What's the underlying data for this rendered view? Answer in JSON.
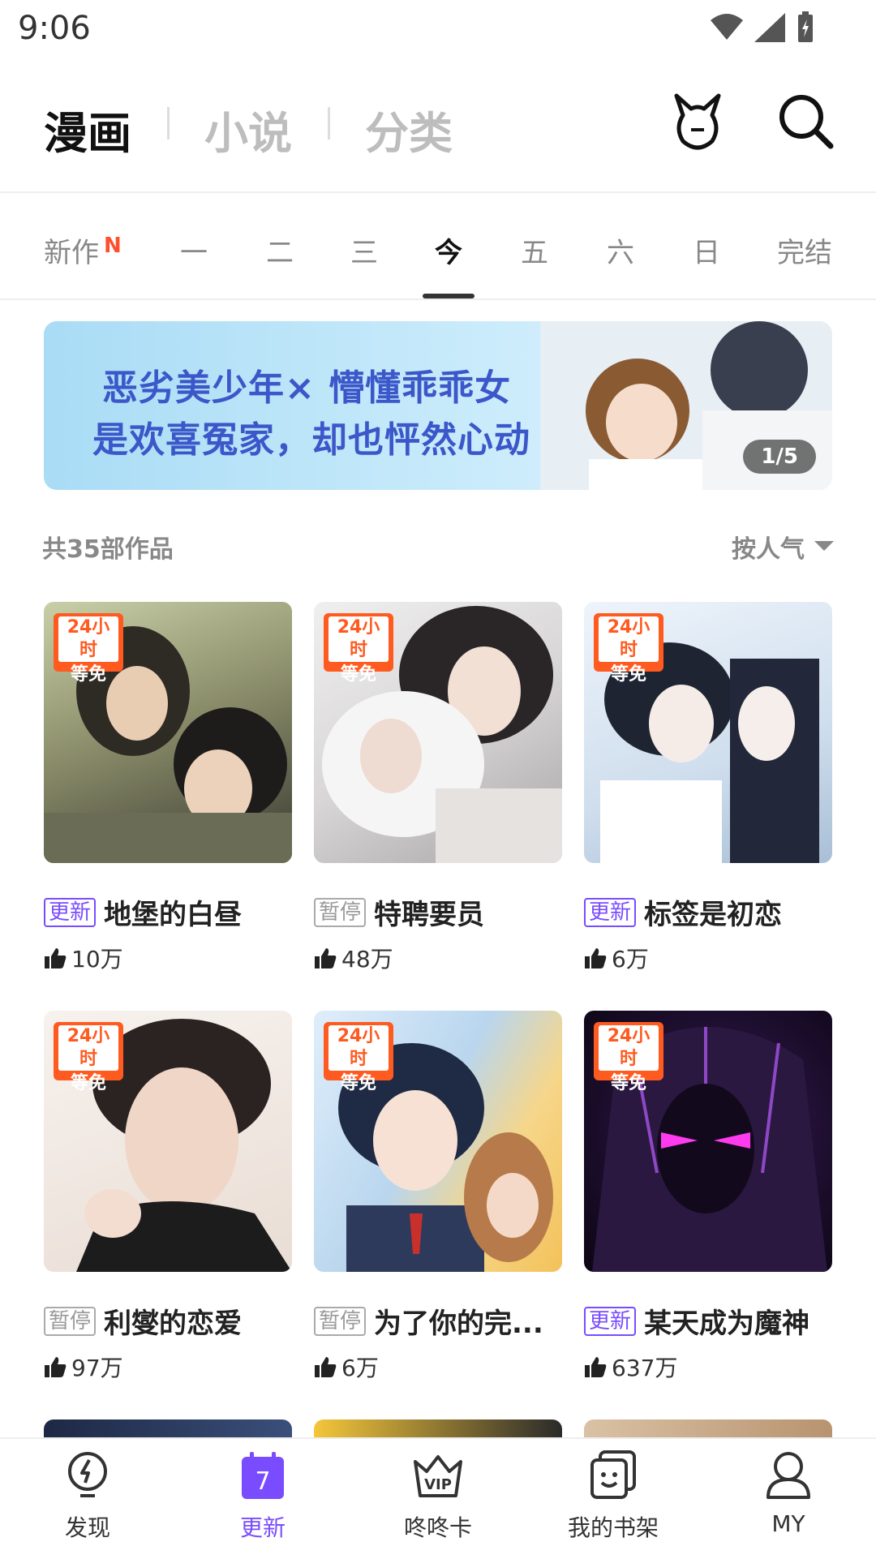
{
  "status": {
    "time": "9:06"
  },
  "top_tabs": [
    {
      "label": "漫画"
    },
    {
      "label": "小说"
    },
    {
      "label": "分类"
    }
  ],
  "day_tabs": [
    {
      "label": "新作",
      "badge": "N"
    },
    {
      "label": "一"
    },
    {
      "label": "二"
    },
    {
      "label": "三"
    },
    {
      "label": "今"
    },
    {
      "label": "五"
    },
    {
      "label": "六"
    },
    {
      "label": "日"
    },
    {
      "label": "完结"
    }
  ],
  "banner": {
    "line1": "恶劣美少年× 懵懂乖乖女",
    "line2": "是欢喜冤家，却也怦然心动",
    "counter": "1/5"
  },
  "summary": {
    "count_text": "共35部作品",
    "sort_label": "按人气"
  },
  "free_tag": {
    "line1": "24小时",
    "line2": "等免"
  },
  "comics": [
    {
      "status": "更新",
      "title": "地堡的白昼",
      "likes": "10万"
    },
    {
      "status": "暂停",
      "title": "特聘要员",
      "likes": "48万"
    },
    {
      "status": "更新",
      "title": "标签是初恋",
      "likes": "6万"
    },
    {
      "status": "暂停",
      "title": "利燮的恋爱",
      "likes": "97万"
    },
    {
      "status": "暂停",
      "title": "为了你的完...",
      "likes": "6万"
    },
    {
      "status": "更新",
      "title": "某天成为魔神",
      "likes": "637万"
    }
  ],
  "bottom_nav": [
    {
      "label": "发现"
    },
    {
      "label": "更新",
      "icon_text": "7"
    },
    {
      "label": "咚咚卡",
      "icon_text": "VIP"
    },
    {
      "label": "我的书架"
    },
    {
      "label": "MY"
    }
  ],
  "colors": {
    "accent": "#7a4cff",
    "free_tag": "#ff5a1f",
    "new_badge": "#ff4d2e"
  }
}
